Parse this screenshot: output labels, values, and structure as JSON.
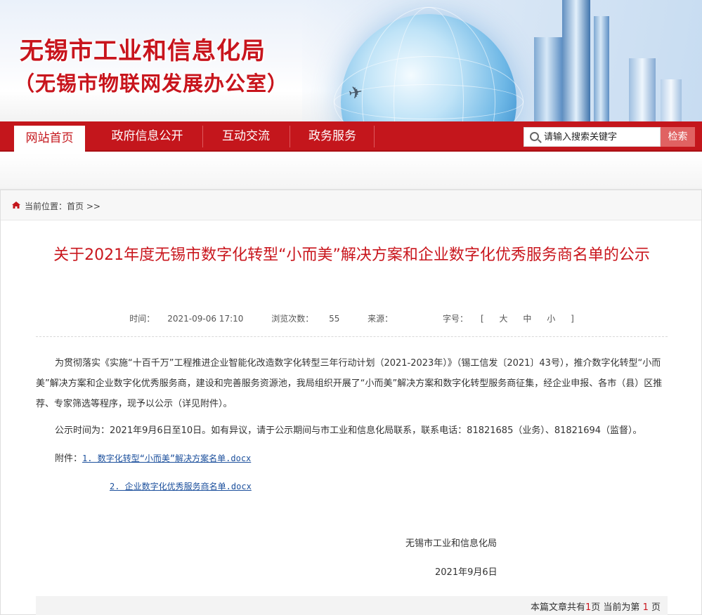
{
  "banner": {
    "title": "无锡市工业和信息化局",
    "subtitle": "（无锡市物联网发展办公室）"
  },
  "nav": {
    "items": [
      {
        "label": "网站首页",
        "active": true
      },
      {
        "label": "政府信息公开",
        "active": false
      },
      {
        "label": "互动交流",
        "active": false
      },
      {
        "label": "政务服务",
        "active": false
      }
    ],
    "search": {
      "placeholder": "请输入搜索关键字",
      "button": "检索"
    }
  },
  "breadcrumb": {
    "prefix": "当前位置：",
    "home": "首页",
    "arrow": ">>"
  },
  "article": {
    "title": "关于2021年度无锡市数字化转型“小而美”解决方案和企业数字化优秀服务商名单的公示",
    "meta": {
      "time_label": "时间：",
      "time": "2021-09-06 17:10",
      "views_label": "浏览次数：",
      "views": "55",
      "source_label": "来源：",
      "source": "",
      "fontsize_label": "字号：",
      "fontsize_open": "[",
      "fontsize_large": "大",
      "fontsize_medium": "中",
      "fontsize_small": "小",
      "fontsize_close": "]"
    },
    "p1": "为贯彻落实《实施“十百千万”工程推进企业智能化改造数字化转型三年行动计划（2021-2023年）》（锡工信发〔2021〕43号），推介数字化转型“小而美”解决方案和企业数字化优秀服务商，建设和完善服务资源池，我局组织开展了“小而美”解决方案和数字化转型服务商征集，经企业申报、各市（县）区推荐、专家筛选等程序，现予以公示（详见附件）。",
    "p2": "公示时间为：2021年9月6日至10日。如有异议，请于公示期间与市工业和信息化局联系，联系电话：81821685（业务）、81821694（监督）。",
    "attachments_label": "附件：",
    "attachment1": "1. 数字化转型“小而美”解决方案名单.docx",
    "attachment2": "2. 企业数字化优秀服务商名单.docx",
    "signature": "无锡市工业和信息化局",
    "date": "2021年9月6日"
  },
  "pager": {
    "text1": "本篇文章共有",
    "total": "1",
    "text2": "页 当前为第",
    "current": "1",
    "text3": "页"
  },
  "colors": {
    "brand_red": "#c4161c",
    "link_blue": "#1b4f9c"
  }
}
